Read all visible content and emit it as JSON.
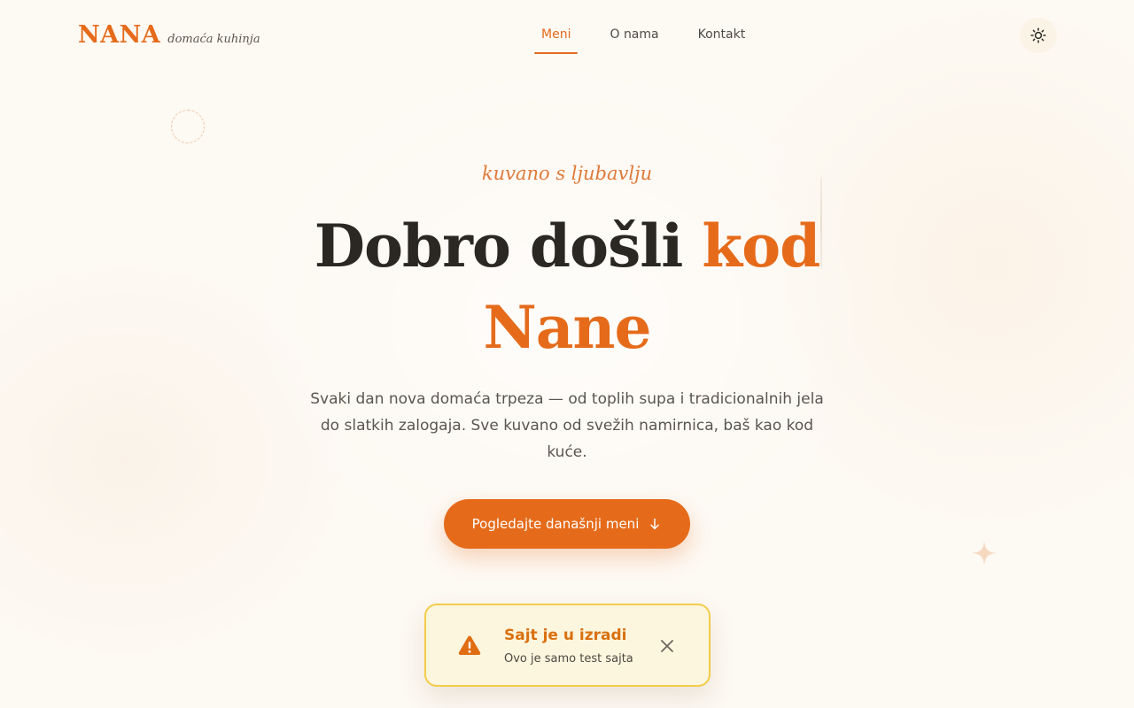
{
  "brand": {
    "name": "NANA",
    "tagline": "domaća kuhinja"
  },
  "nav": {
    "items": [
      {
        "label": "Meni",
        "active": true
      },
      {
        "label": "O nama",
        "active": false
      },
      {
        "label": "Kontakt",
        "active": false
      }
    ]
  },
  "theme_toggle": {
    "icon": "sun-icon"
  },
  "hero": {
    "kicker": "kuvano s ljubavlju",
    "title_part1": "Dobro došli ",
    "title_accent": "kod Nane",
    "description": "Svaki dan nova domaća trpeza — od toplih supa i tradicionalnih jela do slatkih zalogaja. Sve kuvano od svežih namirnica, baš kao kod kuće.",
    "cta_label": "Pogledajte današnji meni",
    "cta_icon": "arrow-down-icon"
  },
  "toast": {
    "icon": "warning-icon",
    "title": "Sajt je u izradi",
    "message": "Ovo je samo test sajta",
    "close_icon": "close-icon"
  },
  "colors": {
    "accent": "#e56b1b",
    "background": "#fdf9f3",
    "toast_bg": "#fdf6df",
    "toast_border": "#f3cc4a"
  }
}
